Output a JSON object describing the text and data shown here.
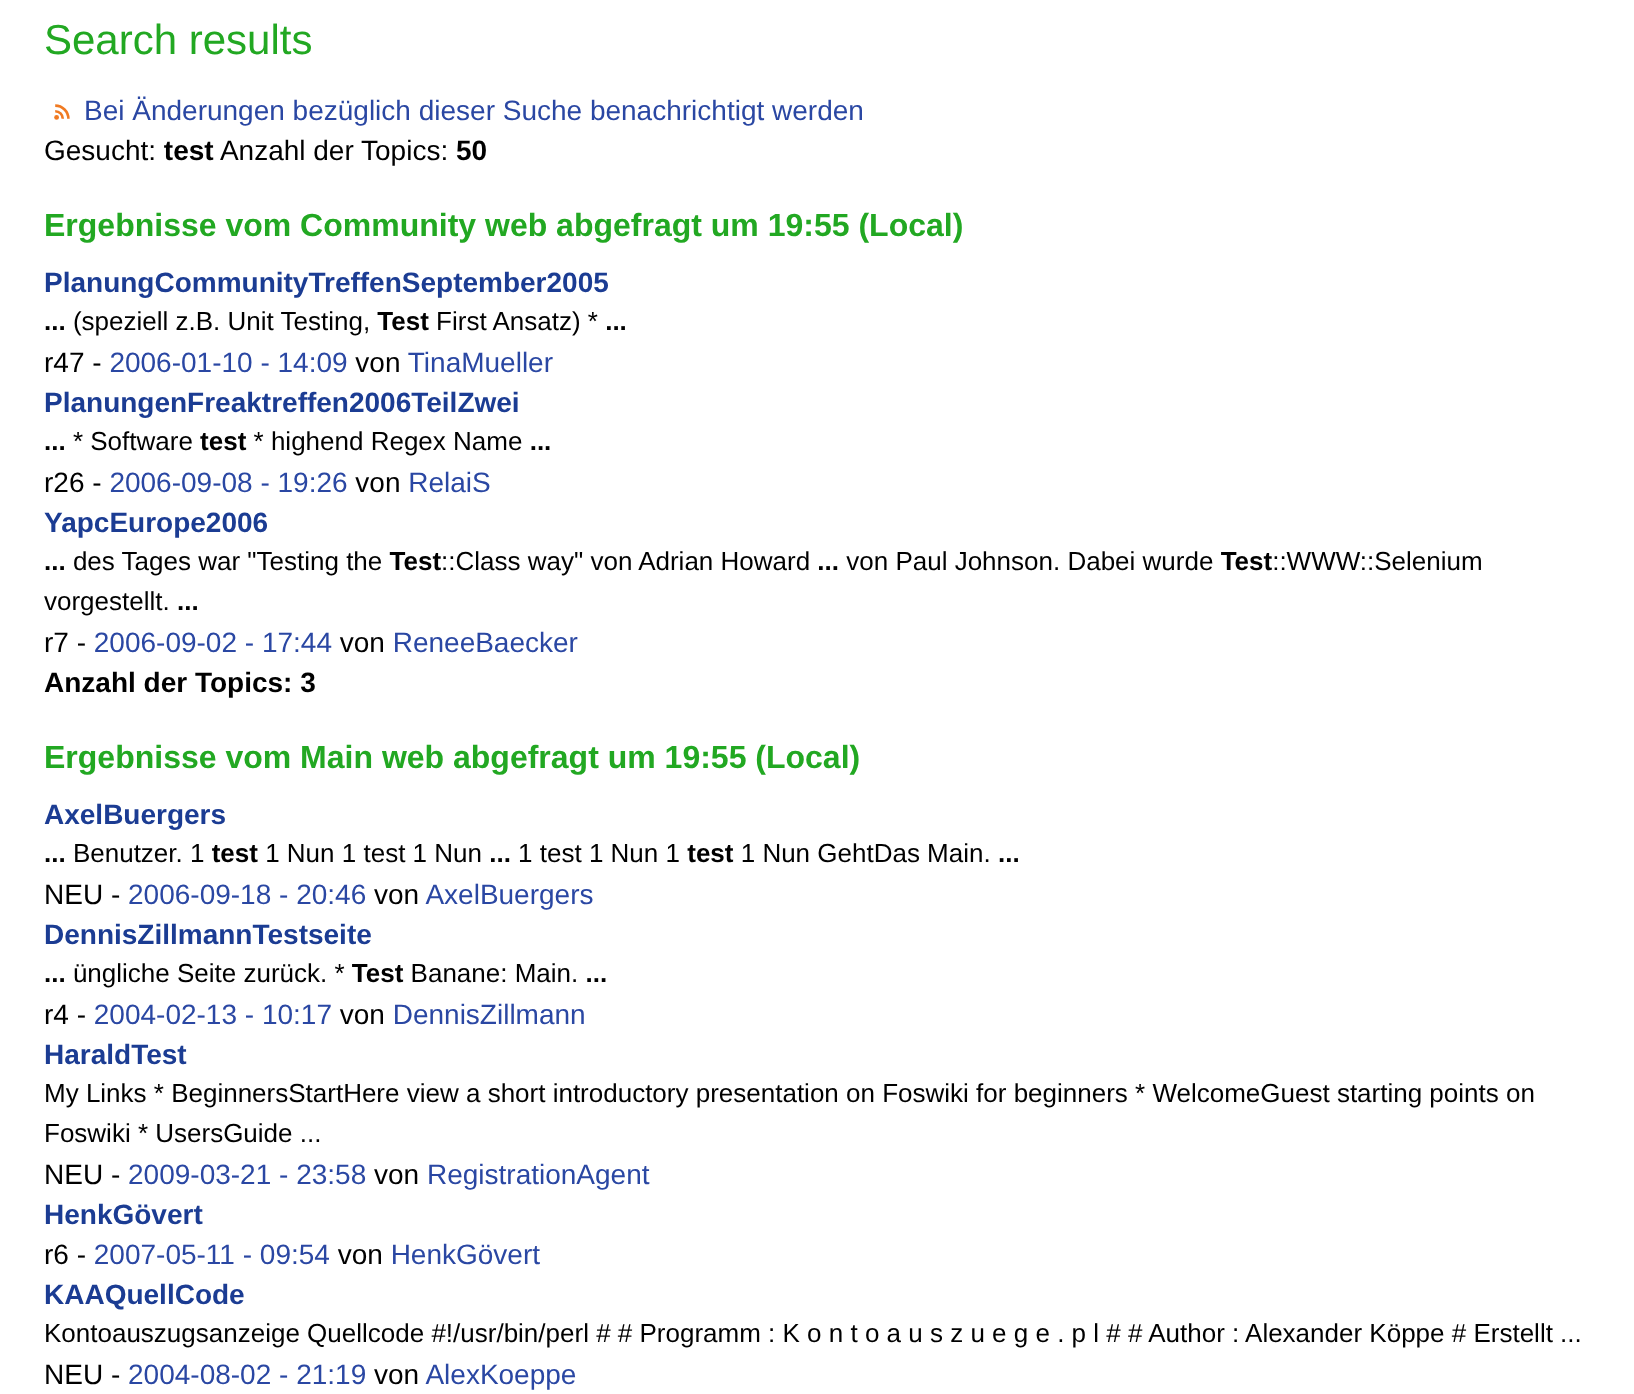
{
  "page": {
    "title": "Search results"
  },
  "notify": {
    "label": "Bei Änderungen bezüglich dieser Suche benachrichtigt werden"
  },
  "summary": [
    {
      "text": "Gesucht: ",
      "bold": false
    },
    {
      "text": "test",
      "bold": true
    },
    {
      "text": " Anzahl der Topics: ",
      "bold": false
    },
    {
      "text": "50",
      "bold": true
    }
  ],
  "sections": [
    {
      "heading": "Ergebnisse vom Community web abgefragt um 19:55 (Local)",
      "results": [
        {
          "topic": "PlanungCommunityTreffenSeptember2005",
          "snippet": [
            {
              "text": "...",
              "bold": true
            },
            {
              "text": " (speziell z.B. Unit Testing, ",
              "bold": false
            },
            {
              "text": "Test",
              "bold": true
            },
            {
              "text": " First Ansatz) * ",
              "bold": false
            },
            {
              "text": "...",
              "bold": true
            }
          ],
          "revision": "r47 -",
          "date": "2006-01-10 - 14:09",
          "by": "von",
          "author": "TinaMueller"
        },
        {
          "topic": "PlanungenFreaktreffen2006TeilZwei",
          "snippet": [
            {
              "text": "...",
              "bold": true
            },
            {
              "text": " * Software ",
              "bold": false
            },
            {
              "text": "test",
              "bold": true
            },
            {
              "text": " * highend Regex Name ",
              "bold": false
            },
            {
              "text": "...",
              "bold": true
            }
          ],
          "revision": "r26 -",
          "date": "2006-09-08 - 19:26",
          "by": "von",
          "author": "RelaiS"
        },
        {
          "topic": "YapcEurope2006",
          "snippet": [
            {
              "text": "...",
              "bold": true
            },
            {
              "text": " des Tages war \"Testing the ",
              "bold": false
            },
            {
              "text": "Test",
              "bold": true
            },
            {
              "text": "::Class way\" von Adrian Howard ",
              "bold": false
            },
            {
              "text": "...",
              "bold": true
            },
            {
              "text": " von Paul Johnson. Dabei wurde ",
              "bold": false
            },
            {
              "text": "Test",
              "bold": true
            },
            {
              "text": "::WWW::Selenium vorgestellt. ",
              "bold": false
            },
            {
              "text": "...",
              "bold": true
            }
          ],
          "revision": "r7 -",
          "date": "2006-09-02 - 17:44",
          "by": "von",
          "author": "ReneeBaecker"
        }
      ],
      "total": "Anzahl der Topics: 3"
    },
    {
      "heading": "Ergebnisse vom Main web abgefragt um 19:55 (Local)",
      "results": [
        {
          "topic": "AxelBuergers",
          "snippet": [
            {
              "text": "...",
              "bold": true
            },
            {
              "text": " Benutzer. 1 ",
              "bold": false
            },
            {
              "text": "test",
              "bold": true
            },
            {
              "text": " 1 Nun 1 test 1 Nun ",
              "bold": false
            },
            {
              "text": "...",
              "bold": true
            },
            {
              "text": " 1 test 1 Nun 1 ",
              "bold": false
            },
            {
              "text": "test",
              "bold": true
            },
            {
              "text": " 1 Nun GehtDas Main. ",
              "bold": false
            },
            {
              "text": "...",
              "bold": true
            }
          ],
          "revision": "NEU -",
          "date": "2006-09-18 - 20:46",
          "by": "von",
          "author": "AxelBuergers"
        },
        {
          "topic": "DennisZillmannTestseite",
          "snippet": [
            {
              "text": "...",
              "bold": true
            },
            {
              "text": " üngliche Seite zurück. * ",
              "bold": false
            },
            {
              "text": "Test",
              "bold": true
            },
            {
              "text": " Banane: Main. ",
              "bold": false
            },
            {
              "text": "...",
              "bold": true
            }
          ],
          "revision": "r4 -",
          "date": "2004-02-13 - 10:17",
          "by": "von",
          "author": "DennisZillmann"
        },
        {
          "topic": "HaraldTest",
          "snippet": [
            {
              "text": "My Links * BeginnersStartHere view a short introductory presentation on Foswiki for beginners * WelcomeGuest starting points on Foswiki * UsersGuide ...",
              "bold": false
            }
          ],
          "revision": "NEU -",
          "date": "2009-03-21 - 23:58",
          "by": "von",
          "author": "RegistrationAgent"
        },
        {
          "topic": "HenkGövert",
          "revision": "r6 -",
          "date": "2007-05-11 - 09:54",
          "by": "von",
          "author": "HenkGövert"
        },
        {
          "topic": "KAAQuellCode",
          "snippet": [
            {
              "text": "Kontoauszugsanzeige Quellcode #!/usr/bin/perl # # Programm : K o n t o a u s z u e g e . p l # # Author : Alexander Köppe # Erstellt ...",
              "bold": false
            }
          ],
          "revision": "NEU -",
          "date": "2004-08-02 - 21:19",
          "by": "von",
          "author": "AlexKoeppe"
        }
      ]
    }
  ]
}
